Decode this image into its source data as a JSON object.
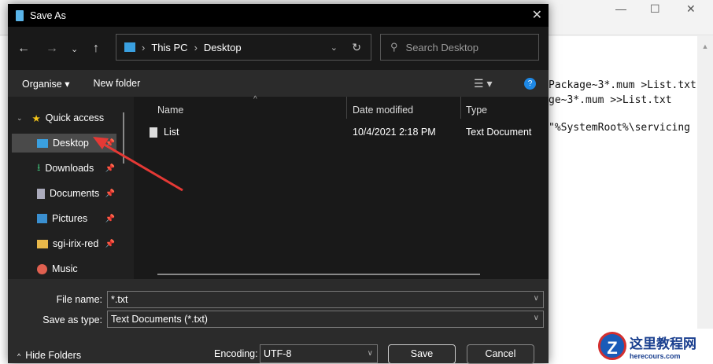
{
  "background": {
    "lines": [
      "Package~3*.mum >List.txt",
      "ge~3*.mum >>List.txt",
      "\"%SystemRoot%\\servicing"
    ]
  },
  "dialog": {
    "title": "Save As",
    "nav": {
      "breadcrumb": [
        "This PC",
        "Desktop"
      ],
      "search_placeholder": "Search Desktop"
    },
    "toolbar": {
      "organise": "Organise",
      "new_folder": "New folder"
    },
    "sidebar": {
      "quick_access": "Quick access",
      "items": [
        "Desktop",
        "Downloads",
        "Documents",
        "Pictures",
        "sgi-irix-red",
        "Music"
      ]
    },
    "columns": {
      "name": "Name",
      "date": "Date modified",
      "type": "Type"
    },
    "files": [
      {
        "name": "List",
        "date": "10/4/2021 2:18 PM",
        "type": "Text Document"
      }
    ],
    "form": {
      "file_name_label": "File name:",
      "file_name": "*.txt",
      "type_label": "Save as type:",
      "type_value": "Text Documents (*.txt)",
      "encoding_label": "Encoding:",
      "encoding": "UTF-8",
      "hide_folders": "Hide Folders",
      "save": "Save",
      "cancel": "Cancel"
    }
  },
  "watermark": {
    "cn": "这里教程网",
    "en": "herecours.com"
  }
}
